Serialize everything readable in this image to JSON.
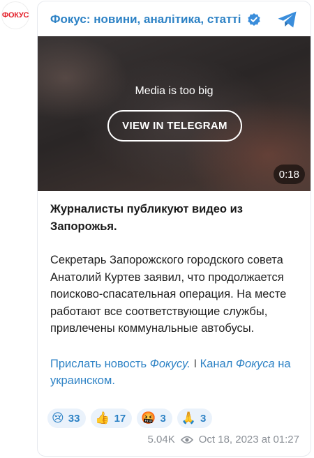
{
  "avatar": {
    "label": "ФОКУС",
    "color": "#e3202a"
  },
  "header": {
    "channel_name": "Фокус: новини, аналітика, статті",
    "verified_icon": "verified-check-icon",
    "app_icon": "telegram-plane-icon"
  },
  "media": {
    "notice": "Media is too big",
    "button_label": "VIEW IN TELEGRAM",
    "duration": "0:18"
  },
  "post": {
    "lead": "Журналисты публикуют видео из Запорожья.",
    "body": "Секретарь Запорожского городского совета Анатолий Куртев заявил, что продолжается поисково-спасательная операция. На месте работают все соответствующие службы, привлечены коммунальные автобусы.",
    "links": {
      "part1": "Прислать новость ",
      "part1_em": "Фокусу.",
      "separator": " I ",
      "part2": "Канал ",
      "part2_em": "Фокуса",
      "part3": " на украинском."
    }
  },
  "reactions": [
    {
      "emoji": "😢",
      "icon": "crying-face-icon",
      "count": "33"
    },
    {
      "emoji": "👍",
      "icon": "thumbs-up-icon",
      "count": "17"
    },
    {
      "emoji": "🤬",
      "icon": "angry-face-icon",
      "count": "3"
    },
    {
      "emoji": "🙏",
      "icon": "folded-hands-icon",
      "count": "3"
    }
  ],
  "meta": {
    "views": "5.04K",
    "timestamp": "Oct 18, 2023 at 01:27"
  },
  "colors": {
    "accent": "#2d82c5",
    "muted": "#8a8f96",
    "reaction_bg": "#eaf2fb"
  }
}
